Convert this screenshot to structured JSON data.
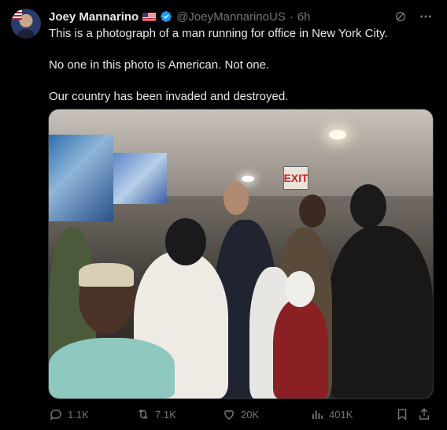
{
  "tweet": {
    "author_name": "Joey Mannarino",
    "handle": "@JoeyMannarinoUS",
    "separator": "·",
    "time": "6h",
    "text_lines": [
      "This is a photograph of a man running for office in New York City.",
      "No one in this photo is American. Not one.",
      "Our country has been invaded and destroyed."
    ],
    "media_exit_sign": "EXIT"
  },
  "metrics": {
    "replies": "1.1K",
    "reposts": "7.1K",
    "likes": "20K",
    "views": "401K"
  },
  "icons": [
    "avatar",
    "us-flag-icon",
    "verified-icon",
    "grok-icon",
    "more-icon",
    "reply-icon",
    "repost-icon",
    "like-icon",
    "views-icon",
    "bookmark-icon",
    "share-icon"
  ],
  "colors": {
    "background": "#000000",
    "text": "#e7e9ea",
    "muted": "#71767b",
    "verified": "#1d9bf0",
    "border": "#2f3336"
  }
}
